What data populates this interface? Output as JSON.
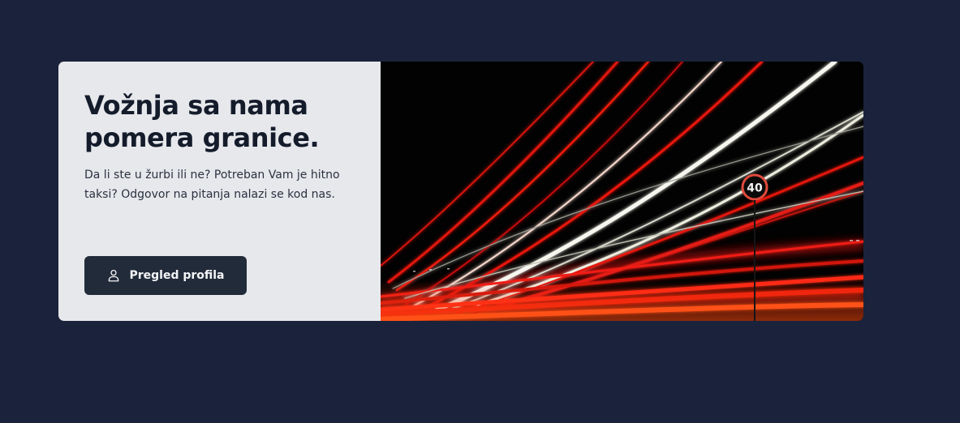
{
  "hero": {
    "title": "Vožnja sa nama pomera granice.",
    "description": "Da li ste u žurbi ili ne? Potreban Vam je hitno taksi? Odgovor na pitanja nalazi se kod nas.",
    "button_label": "Pregled profila",
    "button_icon": "user-icon",
    "image": {
      "speed_sign_text": "40"
    }
  },
  "colors": {
    "page_background": "#1a233b",
    "card_background": "#e7e8ec",
    "button_background": "#222b3a",
    "title_color": "#141c2b",
    "light_trail_red": "#e3160f",
    "light_trail_white": "#f5f5ef"
  }
}
